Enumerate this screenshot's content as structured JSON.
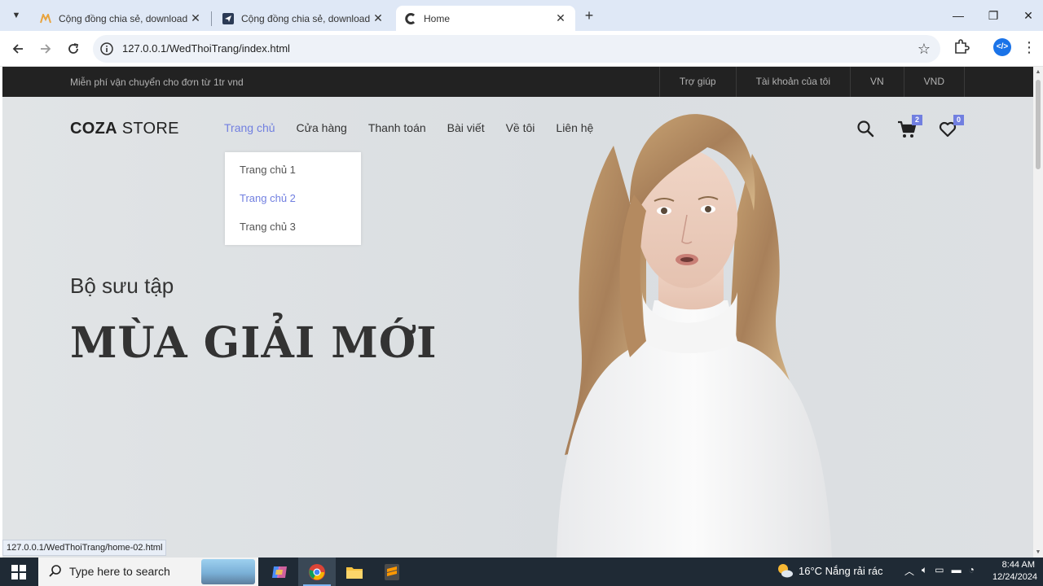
{
  "browser": {
    "tabs": [
      {
        "title": "Cộng đồng chia sẻ, download",
        "icon": "m-logo-icon",
        "active": false
      },
      {
        "title": "Cộng đồng chia sẻ, download",
        "icon": "paper-plane-icon",
        "active": false
      },
      {
        "title": "Home",
        "icon": "c-logo-icon",
        "active": true
      }
    ],
    "url": "127.0.0.1/WedThoiTrang/index.html",
    "status_url": "127.0.0.1/WedThoiTrang/home-02.html"
  },
  "site": {
    "topbar": {
      "promo": "Miễn phí vận chuyển cho đơn từ 1tr vnd",
      "links": [
        "Trợ giúp",
        "Tài khoản của tôi",
        "VN",
        "VND"
      ]
    },
    "logo": {
      "bold": "COZA",
      "rest": " STORE"
    },
    "nav": [
      "Trang chủ",
      "Cửa hàng",
      "Thanh toán",
      "Bài viết",
      "Về tôi",
      "Liên hệ"
    ],
    "dropdown": [
      "Trang chủ 1",
      "Trang chủ 2",
      "Trang chủ 3"
    ],
    "cart_count": "2",
    "wishlist_count": "0",
    "hero": {
      "subtitle": "Bộ sưu tập",
      "title": "MÙA GIẢI MỚI"
    }
  },
  "taskbar": {
    "search_placeholder": "Type here to search",
    "weather": "16°C  Nắng rải rác",
    "time": "8:44 AM",
    "date": "12/24/2024"
  },
  "colors": {
    "accent": "#717fe0",
    "topbar_bg": "#222222",
    "hero_bg": "#e1e4e6"
  }
}
